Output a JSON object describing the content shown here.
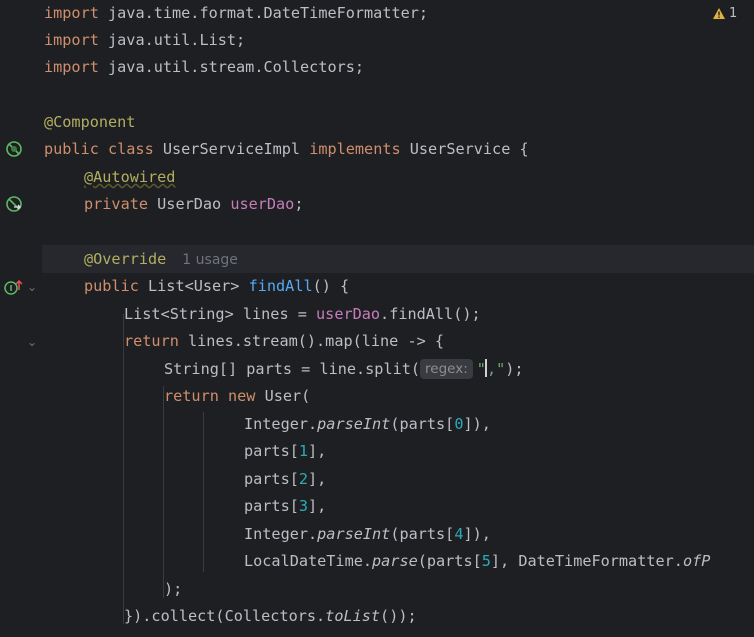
{
  "inspections": {
    "warning_count": "1",
    "icon": "warning-triangle-icon",
    "color": "#e0b13e"
  },
  "gutter": {
    "bean_icon_1": "spring-bean-icon",
    "bean_icon_2": "spring-bean-autowired-icon",
    "impl_icon": "implementing-method-icon",
    "fold_icons": "chevron-down-icon"
  },
  "code": {
    "l1_kw": "import",
    "l1_rest": " java.time.format.DateTimeFormatter;",
    "l2_kw": "import",
    "l2_rest": " java.util.List;",
    "l3_kw": "import",
    "l3_rest": " java.util.stream.Collectors;",
    "l5_ann": "@Component",
    "l6_kw1": "public class",
    "l6_name": " UserServiceImpl ",
    "l6_kw2": "implements",
    "l6_rest": " UserService {",
    "l7_ann": "@Autowired",
    "l8_kw": "private",
    "l8_type": " UserDao ",
    "l8_field": "userDao",
    "l8_end": ";",
    "l10_ann": "@Override",
    "l10_usage": "1 usage",
    "l11_kw": "public",
    "l11_type": " List<User> ",
    "l11_fn": "findAll",
    "l11_end": "() {",
    "l12_type": "List<String> lines = ",
    "l12_field": "userDao",
    "l12_end": ".findAll();",
    "l13_kw": "return",
    "l13_rest": " lines.stream().map(line -> {",
    "l14_start": "String[] parts = line.split(",
    "l14_hint": "regex:",
    "l14_str_open": "\"",
    "l14_str_body": ",\"",
    "l14_end": ");",
    "l15_kw1": "return",
    "l15_kw2": " new",
    "l15_rest": " User(",
    "l16_a": "Integer.",
    "l16_fn": "parseInt",
    "l16_b": "(parts[",
    "l16_num": "0",
    "l16_c": "]),",
    "l17_a": "parts[",
    "l17_num": "1",
    "l17_c": "],",
    "l18_a": "parts[",
    "l18_num": "2",
    "l18_c": "],",
    "l19_a": "parts[",
    "l19_num": "3",
    "l19_c": "],",
    "l20_a": "Integer.",
    "l20_fn": "parseInt",
    "l20_b": "(parts[",
    "l20_num": "4",
    "l20_c": "]),",
    "l21_a": "LocalDateTime.",
    "l21_fn": "parse",
    "l21_b": "(parts[",
    "l21_num": "5",
    "l21_c": "], DateTimeFormatter.",
    "l21_fn2": "ofP",
    "l22_text": ");",
    "l23_a": "}).collect(Collectors.",
    "l23_fn": "toList",
    "l23_c": "());"
  }
}
